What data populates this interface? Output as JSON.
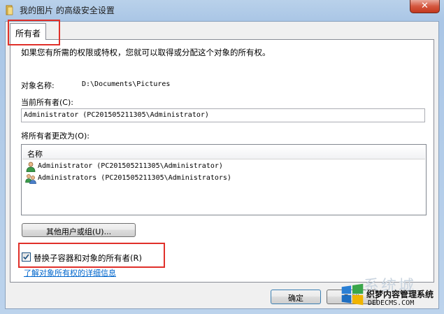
{
  "window": {
    "title": "我的图片 的高级安全设置",
    "close_glyph": "✕"
  },
  "tabs": [
    {
      "label": "所有者"
    }
  ],
  "owner_panel": {
    "intro": "如果您有所需的权限或特权，您就可以取得或分配这个对象的所有权。",
    "object_name_label": "对象名称:",
    "object_name_value": "D:\\Documents\\Pictures",
    "current_owner_label": "当前所有者(C):",
    "current_owner_value": "Administrator (PC201505211305\\Administrator)",
    "change_owner_label": "将所有者更改为(O):",
    "list_header": "名称",
    "list_items": [
      {
        "name": "Administrator (PC201505211305\\Administrator)",
        "icon": "user-icon"
      },
      {
        "name": "Administrators (PC201505211305\\Administrators)",
        "icon": "group-icon"
      }
    ],
    "other_users_button": "其他用户或组(U)...",
    "replace_owner_checkbox": {
      "label": "替换子容器和对象的所有者(R)",
      "checked": true
    },
    "learn_more_link": "了解对象所有权的详细信息"
  },
  "footer": {
    "ok_button": "确定",
    "cancel_button": "取消"
  },
  "watermark": {
    "top_text": "系统城",
    "line1": "织梦内容管理系统",
    "line2": "DEDECMS.COM"
  },
  "colors": {
    "highlight_red": "#e0302a",
    "link_blue": "#0066cc",
    "checkbox_check": "#1c5180"
  }
}
